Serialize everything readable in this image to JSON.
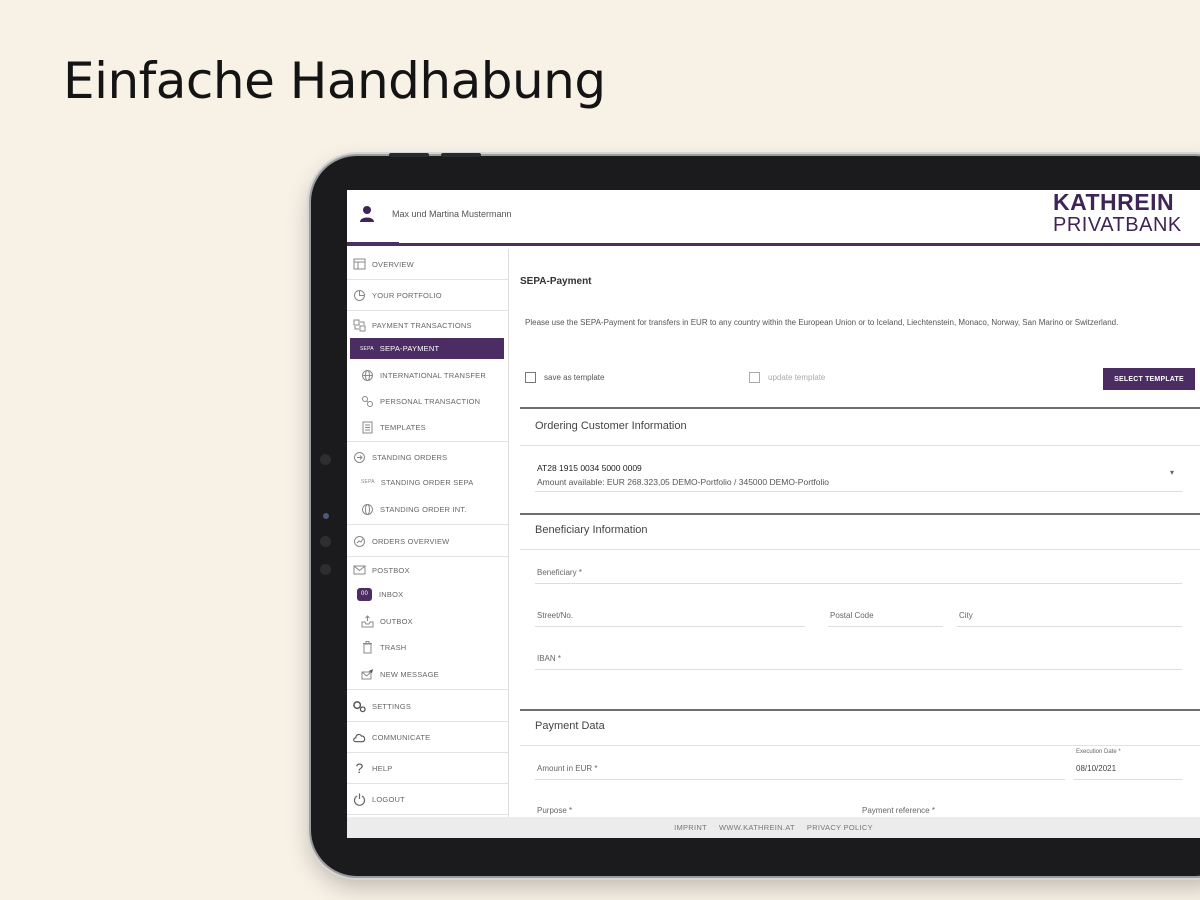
{
  "headline": "Einfache Handhabung",
  "colors": {
    "brand": "#4b2d63",
    "background": "#f8f1e6"
  },
  "header": {
    "user_name": "Max und Martina Mustermann",
    "logo_line1": "KATHREIN",
    "logo_line2": "PRIVATBANK"
  },
  "sidebar": {
    "overview": "OVERVIEW",
    "portfolio": "YOUR PORTFOLIO",
    "payment_transactions": "PAYMENT TRANSACTIONS",
    "sepa_payment": "SEPA-PAYMENT",
    "international_transfer": "INTERNATIONAL TRANSFER",
    "personal_transaction": "PERSONAL TRANSACTION",
    "templates": "TEMPLATES",
    "standing_orders": "STANDING ORDERS",
    "standing_order_sepa": "STANDING ORDER SEPA",
    "standing_order_int": "STANDING ORDER INT.",
    "orders_overview": "ORDERS OVERVIEW",
    "postbox": "POSTBOX",
    "inbox": "INBOX",
    "inbox_badge": "00",
    "outbox": "OUTBOX",
    "trash": "TRASH",
    "new_message": "NEW MESSAGE",
    "settings": "SETTINGS",
    "communicate": "COMMUNICATE",
    "help": "HELP",
    "logout": "LOGOUT"
  },
  "main": {
    "title": "SEPA-Payment",
    "description": "Please use the SEPA-Payment for transfers in EUR to any country within the European Union or to Iceland, Liechtenstein, Monaco, Norway, San Marino or Switzerland.",
    "save_template": "save as template",
    "update_template": "update template",
    "select_template": "SELECT TEMPLATE",
    "ordering_header": "Ordering Customer Information",
    "account_number": "AT28 1915 0034 5000 0009",
    "amount_available": "Amount available:  EUR 268.323,05  DEMO-Portfolio / 345000  DEMO-Portfolio",
    "beneficiary_header": "Beneficiary Information",
    "beneficiary_label": "Beneficiary *",
    "street_label": "Street/No.",
    "postal_label": "Postal Code",
    "city_label": "City",
    "iban_label": "IBAN *",
    "payment_header": "Payment Data",
    "amount_label": "Amount in EUR *",
    "execution_date_label": "Execution Date *",
    "execution_date_value": "08/10/2021",
    "purpose_label": "Purpose *",
    "payment_reference_label": "Payment reference *"
  },
  "footer": {
    "imprint": "IMPRINT",
    "website": "WWW.KATHREIN.AT",
    "privacy": "PRIVACY POLICY"
  }
}
